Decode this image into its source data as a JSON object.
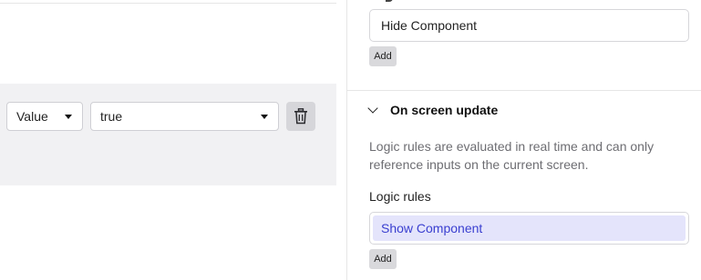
{
  "condition": {
    "type_select": {
      "value": "Value"
    },
    "value_select": {
      "value": "true"
    },
    "delete_icon": "trash-icon"
  },
  "rules_panel": {
    "top_field": {
      "value": "Hide Component"
    },
    "add_label": "Add",
    "section": {
      "title": "On screen update",
      "chevron_icon": "chevron-down-icon",
      "help": "Logic rules are evaluated in real time and can only reference inputs on the current screen.",
      "field_label": "Logic rules",
      "rule_chip": "Show Component"
    }
  },
  "colors": {
    "band": "#f1f1f3",
    "chip_bg": "#e4e4fb",
    "chip_text": "#3a3fd0",
    "button_bg": "#d9d9dc"
  }
}
